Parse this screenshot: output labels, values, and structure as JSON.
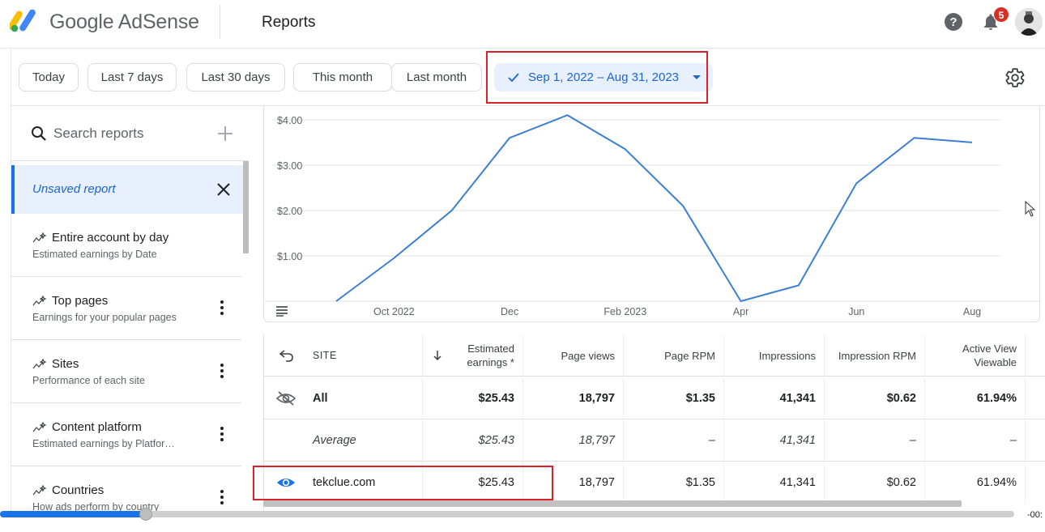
{
  "header": {
    "brand": "Google AdSense",
    "page_title": "Reports",
    "notification_count": "5",
    "colors": {
      "blue": "#4285f4",
      "yellow": "#fbbc04",
      "green": "#34a853"
    }
  },
  "filters": {
    "chips": [
      "Today",
      "Last 7 days",
      "Last 30 days",
      "This month",
      "Last month"
    ],
    "selected_range": "Sep 1, 2022 – Aug 31, 2023"
  },
  "sidebar": {
    "search_placeholder": "Search reports",
    "unsaved_label": "Unsaved report",
    "reports": [
      {
        "title": "Entire account by day",
        "subtitle": "Estimated earnings by Date"
      },
      {
        "title": "Top pages",
        "subtitle": "Earnings for your popular pages"
      },
      {
        "title": "Sites",
        "subtitle": "Performance of each site"
      },
      {
        "title": "Content platform",
        "subtitle": "Estimated earnings by Platfor…"
      },
      {
        "title": "Countries",
        "subtitle": "How ads perform by country"
      }
    ]
  },
  "chart_data": {
    "type": "line",
    "x": [
      "2022-09",
      "2022-10",
      "2022-11",
      "2022-12",
      "2023-01",
      "2023-02",
      "2023-03",
      "2023-04",
      "2023-05",
      "2023-06",
      "2023-07",
      "2023-08"
    ],
    "series": [
      {
        "values": [
          0.0,
          0.95,
          2.0,
          3.6,
          4.1,
          3.35,
          2.1,
          0.0,
          0.35,
          2.6,
          3.6,
          3.5
        ]
      }
    ],
    "yticks": [
      "$1.00",
      "$2.00",
      "$3.00",
      "$4.00"
    ],
    "ytick_values": [
      1,
      2,
      3,
      4
    ],
    "xticks": [
      "Oct 2022",
      "Dec",
      "Feb 2023",
      "Apr",
      "Jun",
      "Aug"
    ],
    "xtick_index": [
      1,
      3,
      5,
      7,
      9,
      11
    ],
    "ylim": [
      0,
      4.3
    ],
    "grid": true,
    "color": "#3d7fd3"
  },
  "table": {
    "headers": {
      "site": "SITE",
      "earnings_1": "Estimated",
      "earnings_2": "earnings *",
      "page_views": "Page views",
      "page_rpm": "Page RPM",
      "impressions": "Impressions",
      "impression_rpm": "Impression RPM",
      "active_view_1": "Active View",
      "active_view_2": "Viewable"
    },
    "rows": [
      {
        "site": "All",
        "earnings": "$25.43",
        "page_views": "18,797",
        "page_rpm": "$1.35",
        "impressions": "41,341",
        "impression_rpm": "$0.62",
        "active_view": "61.94%"
      },
      {
        "site": "Average",
        "earnings": "$25.43",
        "page_views": "18,797",
        "page_rpm": "–",
        "impressions": "41,341",
        "impression_rpm": "–",
        "active_view": "–"
      },
      {
        "site": "tekclue.com",
        "earnings": "$25.43",
        "page_views": "18,797",
        "page_rpm": "$1.35",
        "impressions": "41,341",
        "impression_rpm": "$0.62",
        "active_view": "61.94%"
      }
    ]
  },
  "video": {
    "time": "-00:"
  }
}
